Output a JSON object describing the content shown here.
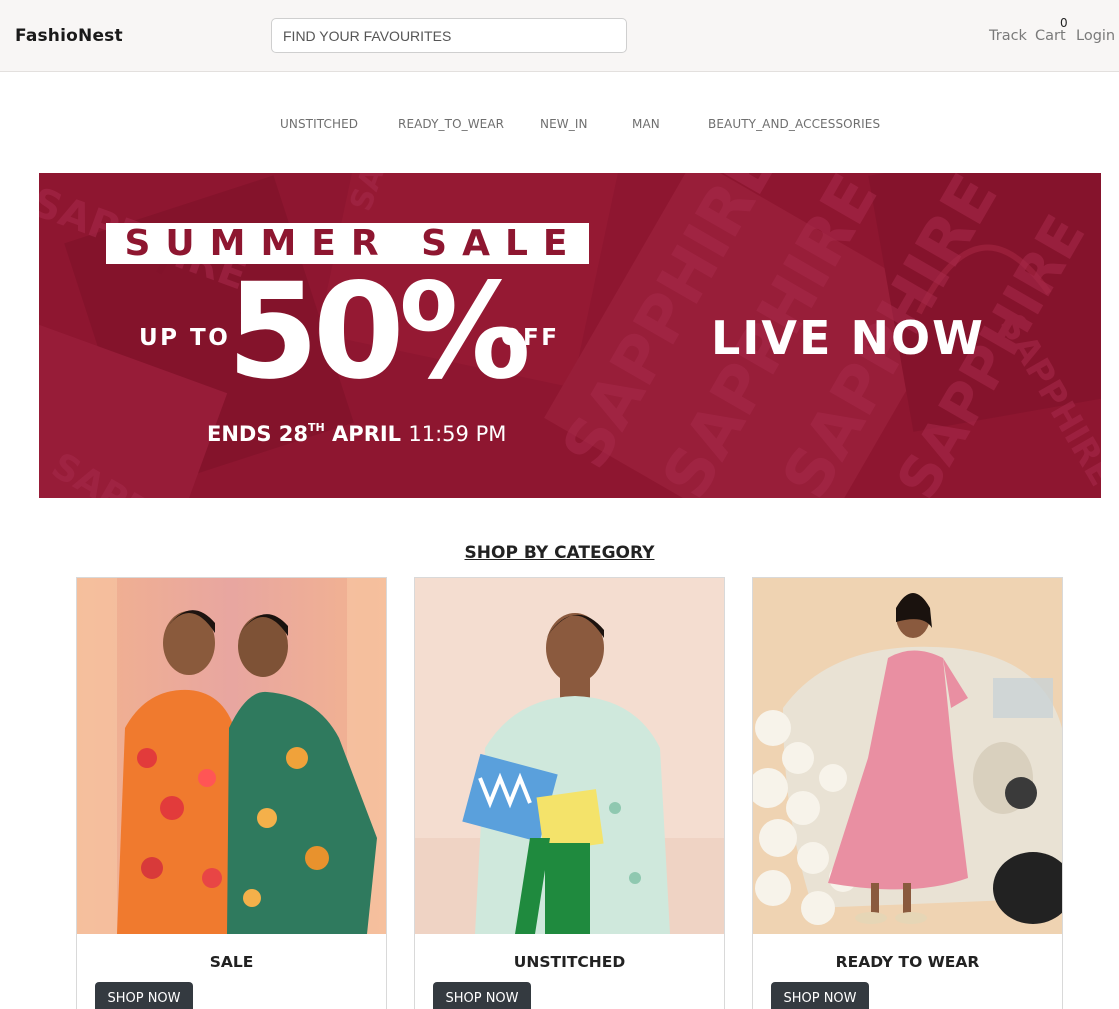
{
  "header": {
    "brand": "FashioNest",
    "search_placeholder": "FIND YOUR FAVOURITES",
    "track_label": "Track",
    "cart_label": "Cart",
    "cart_count": "0",
    "login_label": "Login"
  },
  "nav": {
    "items": [
      "UNSTITCHED",
      "READY_TO_WEAR",
      "NEW_IN",
      "MAN",
      "BEAUTY_AND_ACCESSORIES"
    ]
  },
  "banner": {
    "headline": "SUMMER SALE",
    "up_to": "UP TO",
    "percent": "50%",
    "off": "OFF",
    "ends_prefix": "ENDS 28",
    "ends_sup": "TH",
    "ends_month": "APRIL",
    "ends_time": "11:59 PM",
    "live": "LIVE NOW",
    "watermark": "SAPPHIRE",
    "colors": {
      "background": "#8e1630",
      "text": "#ffffff"
    }
  },
  "section": {
    "title": "SHOP BY CATEGORY"
  },
  "categories": [
    {
      "title": "SALE",
      "button": "SHOP NOW"
    },
    {
      "title": "UNSTITCHED",
      "button": "SHOP NOW"
    },
    {
      "title": "READY TO WEAR",
      "button": "SHOP NOW"
    }
  ],
  "colors": {
    "header_bg": "#f8f6f5",
    "button_bg": "#343a40"
  }
}
